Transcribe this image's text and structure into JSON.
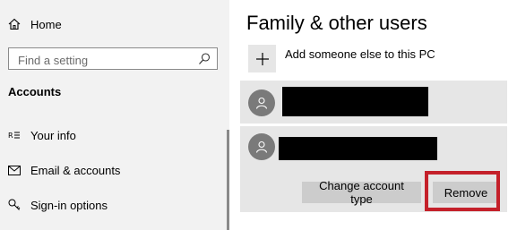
{
  "sidebar": {
    "home_label": "Home",
    "search_placeholder": "Find a setting",
    "section_title": "Accounts",
    "items": [
      {
        "label": "Your info",
        "icon": "person-card-icon"
      },
      {
        "label": "Email & accounts",
        "icon": "mail-icon"
      },
      {
        "label": "Sign-in options",
        "icon": "key-icon"
      }
    ]
  },
  "main": {
    "title": "Family & other users",
    "add_label": "Add someone else to this PC",
    "users": [
      {
        "name": "",
        "redacted": true
      },
      {
        "name": "",
        "redacted": true
      }
    ],
    "buttons": {
      "change_type": "Change account type",
      "remove": "Remove"
    }
  },
  "colors": {
    "sidebar_bg": "#f2f2f2",
    "card_bg": "#e6e6e6",
    "button_bg": "#cccccc",
    "highlight": "#c4202a"
  }
}
